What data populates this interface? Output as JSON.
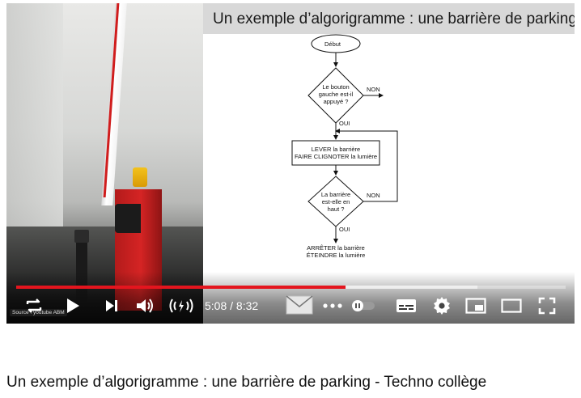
{
  "slide": {
    "title": "Un exemple d’algorigramme : une barrière de parking"
  },
  "flowchart": {
    "start": "Début",
    "decision1": [
      "Le bouton",
      "gauche  est-il",
      "appuyé ?"
    ],
    "decision1_no": "NON",
    "decision1_yes": "OUI",
    "process1": [
      "LEVER la barrière",
      "FAIRE CLIGNOTER la lumière"
    ],
    "decision2": [
      "La barrière",
      "est-elle en",
      "haut ?"
    ],
    "decision2_no": "NON",
    "decision2_yes": "OUI",
    "end": [
      "ARRÊTER la barrière",
      "ÉTEINDRE la lumière"
    ]
  },
  "player": {
    "time": "5:08 / 8:32",
    "progress_played_fraction": 0.6,
    "progress_buffered_fraction": 0.84,
    "watermark": "Source : youtube ABM",
    "accent_color": "#e4151e",
    "icons": [
      "repeat-icon",
      "play-icon",
      "next-icon",
      "volume-icon",
      "cast-icon",
      "mail-icon",
      "more-icon",
      "autoplay-toggle-icon",
      "subtitles-icon",
      "settings-icon",
      "miniplayer-icon",
      "theater-icon",
      "fullscreen-icon"
    ]
  },
  "video": {
    "title": "Un exemple d’algorigramme : une barrière de parking - Techno collège"
  }
}
